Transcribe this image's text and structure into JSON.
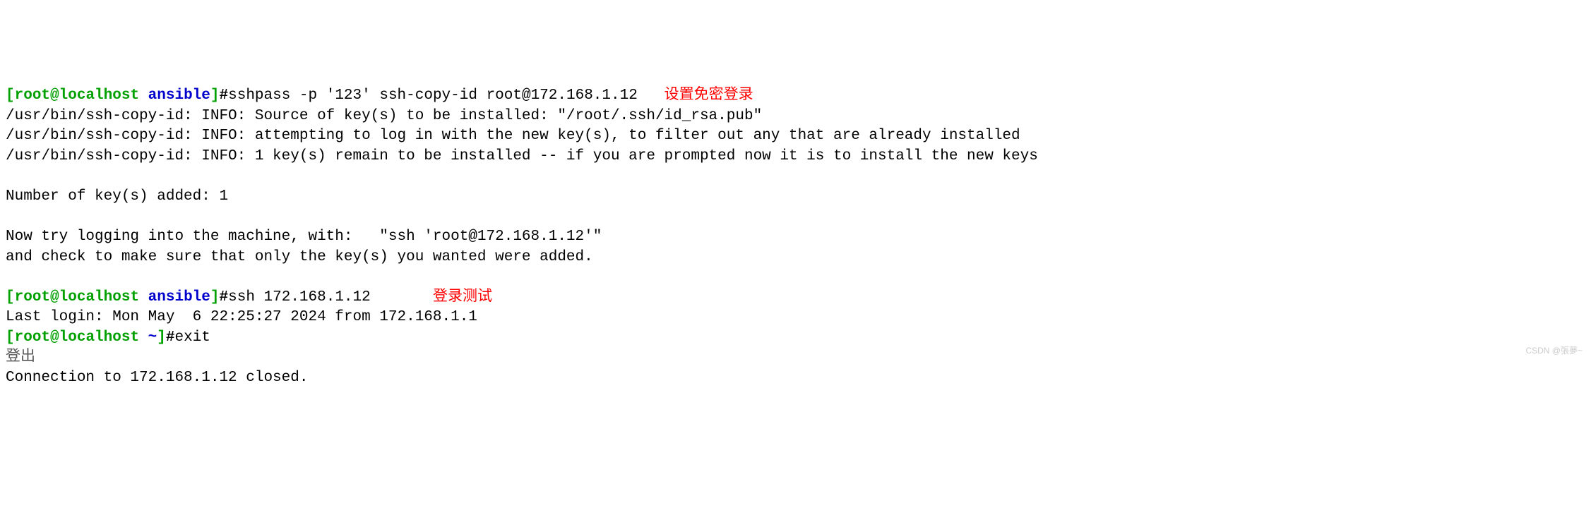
{
  "prompt1": {
    "open": "[",
    "user": "root",
    "at": "@",
    "host": "localhost",
    "space": " ",
    "path": "ansible",
    "close": "]",
    "hash": "#"
  },
  "cmd1": "sshpass -p '123' ssh-copy-id root@172.168.1.12",
  "ann1": "设置免密登录",
  "out1": "/usr/bin/ssh-copy-id: INFO: Source of key(s) to be installed: \"/root/.ssh/id_rsa.pub\"",
  "out2": "/usr/bin/ssh-copy-id: INFO: attempting to log in with the new key(s), to filter out any that are already installed",
  "out3": "/usr/bin/ssh-copy-id: INFO: 1 key(s) remain to be installed -- if you are prompted now it is to install the new keys",
  "out4": "",
  "out5": "Number of key(s) added: 1",
  "out6": "",
  "out7": "Now try logging into the machine, with:   \"ssh 'root@172.168.1.12'\"",
  "out8": "and check to make sure that only the key(s) you wanted were added.",
  "out9": "",
  "prompt2": {
    "open": "[",
    "user": "root",
    "at": "@",
    "host": "localhost",
    "space": " ",
    "path": "ansible",
    "close": "]",
    "hash": "#"
  },
  "cmd2": "ssh 172.168.1.12",
  "ann2": "登录测试",
  "out10": "Last login: Mon May  6 22:25:27 2024 from 172.168.1.1",
  "prompt3": {
    "open": "[",
    "user": "root",
    "at": "@",
    "host": "localhost",
    "space": " ",
    "path": "~",
    "close": "]",
    "hash": "#"
  },
  "cmd3": "exit",
  "out11": "登出",
  "out12": "Connection to 172.168.1.12 closed.",
  "watermark": "CSDN @張夢~"
}
